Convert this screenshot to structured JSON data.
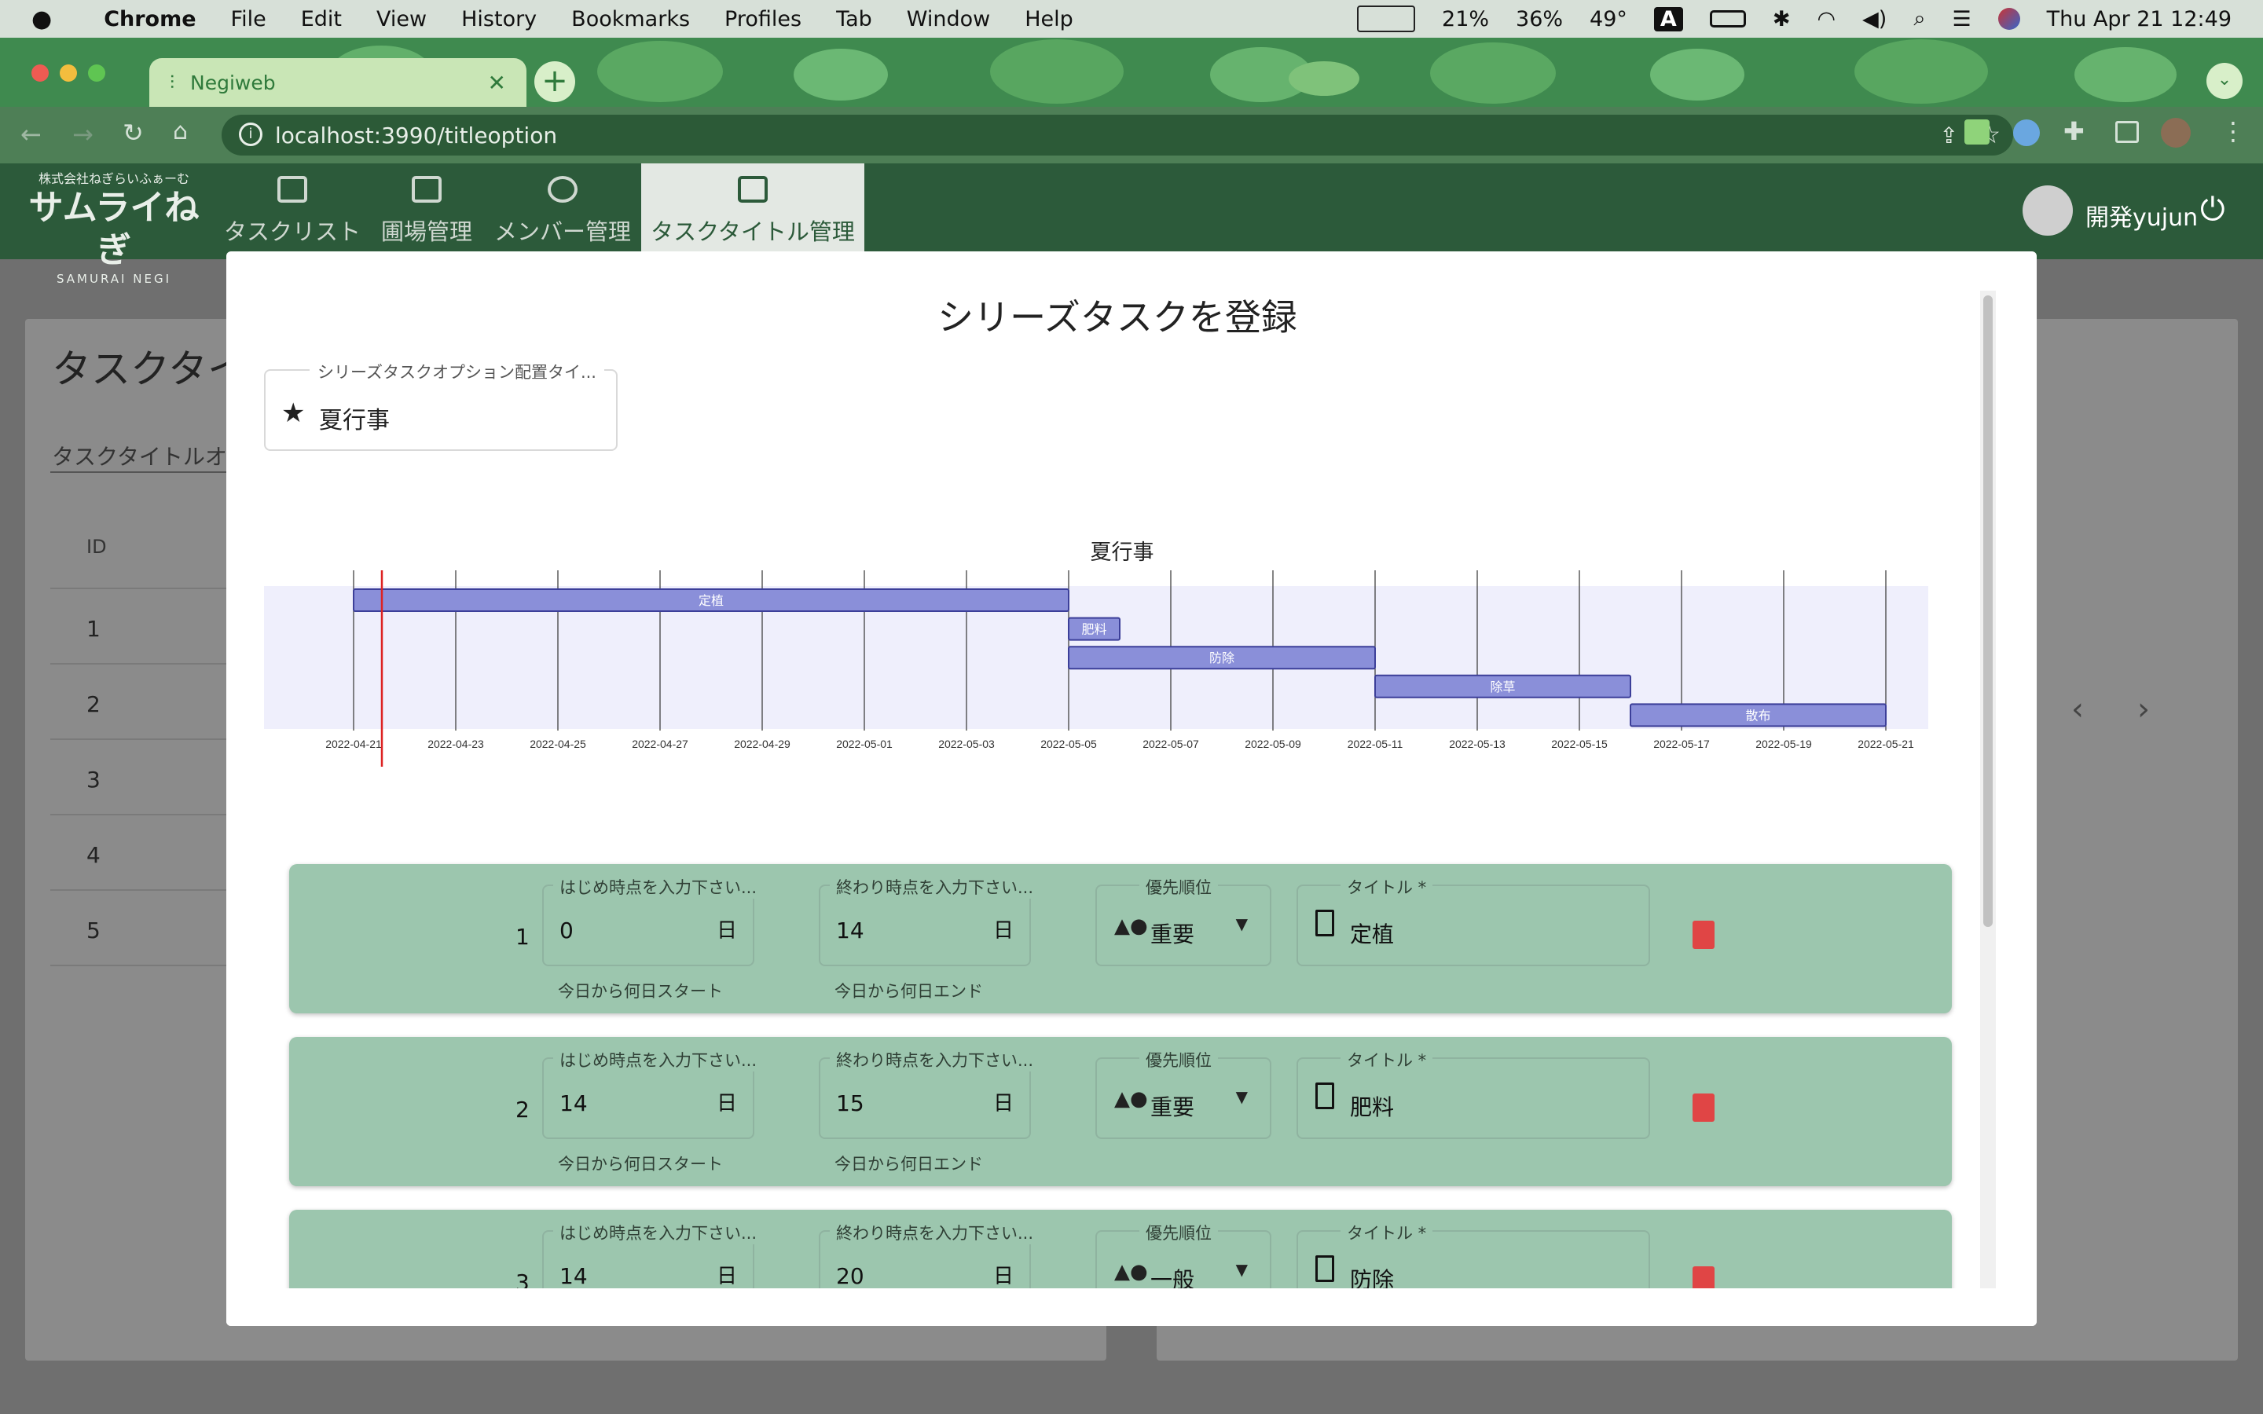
{
  "menubar": {
    "app": "Chrome",
    "items": [
      "File",
      "Edit",
      "View",
      "History",
      "Bookmarks",
      "Profiles",
      "Tab",
      "Window",
      "Help"
    ],
    "status": {
      "ram": "21%",
      "ssd": "36%",
      "temp": "49°",
      "input": "A",
      "datetime": "Thu Apr 21  12:49"
    }
  },
  "browser": {
    "tab_title": "Negiweb",
    "url": "localhost:3990/titleoption"
  },
  "app": {
    "logo_top": "株式会社ねぎらいふぁーむ",
    "logo_main": "サムライねぎ",
    "logo_sub": "SAMURAI NEGI",
    "nav": [
      "タスクリスト",
      "圃場管理",
      "メンバー管理",
      "タスクタイトル管理"
    ],
    "user": "開発yujun"
  },
  "background_page": {
    "title": "タスクタイ",
    "search_label": "タスクタイトルオ",
    "id_header": "ID",
    "ids": [
      "1",
      "2",
      "3",
      "4",
      "5"
    ]
  },
  "modal": {
    "title": "シリーズタスクを登録",
    "option_label": "シリーズタスクオプション配置タイ...",
    "option_value": "夏行事",
    "rows": [
      {
        "num": "1",
        "start": "0",
        "end": "14",
        "priority": "重要",
        "title": "定植"
      },
      {
        "num": "2",
        "start": "14",
        "end": "15",
        "priority": "重要",
        "title": "肥料"
      },
      {
        "num": "3",
        "start": "14",
        "end": "20",
        "priority": "一般",
        "title": "防除"
      }
    ],
    "labels": {
      "start": "はじめ時点を入力下さい...",
      "end": "終わり時点を入力下さい...",
      "priority": "優先順位",
      "title": "タイトル *",
      "day_suffix": "日",
      "start_helper": "今日から何日スタート",
      "end_helper": "今日から何日エンド"
    }
  },
  "chart_data": {
    "type": "gantt",
    "title": "夏行事",
    "x_ticks": [
      "2022-04-21",
      "2022-04-23",
      "2022-04-25",
      "2022-04-27",
      "2022-04-29",
      "2022-05-01",
      "2022-05-03",
      "2022-05-05",
      "2022-05-07",
      "2022-05-09",
      "2022-05-11",
      "2022-05-13",
      "2022-05-15",
      "2022-05-17",
      "2022-05-19",
      "2022-05-21"
    ],
    "today": "2022-04-21",
    "tasks": [
      {
        "name": "定植",
        "start": "2022-04-21",
        "end": "2022-05-05"
      },
      {
        "name": "肥料",
        "start": "2022-05-05",
        "end": "2022-05-06"
      },
      {
        "name": "防除",
        "start": "2022-05-05",
        "end": "2022-05-11"
      },
      {
        "name": "除草",
        "start": "2022-05-11",
        "end": "2022-05-16"
      },
      {
        "name": "散布",
        "start": "2022-05-16",
        "end": "2022-05-21"
      }
    ]
  }
}
